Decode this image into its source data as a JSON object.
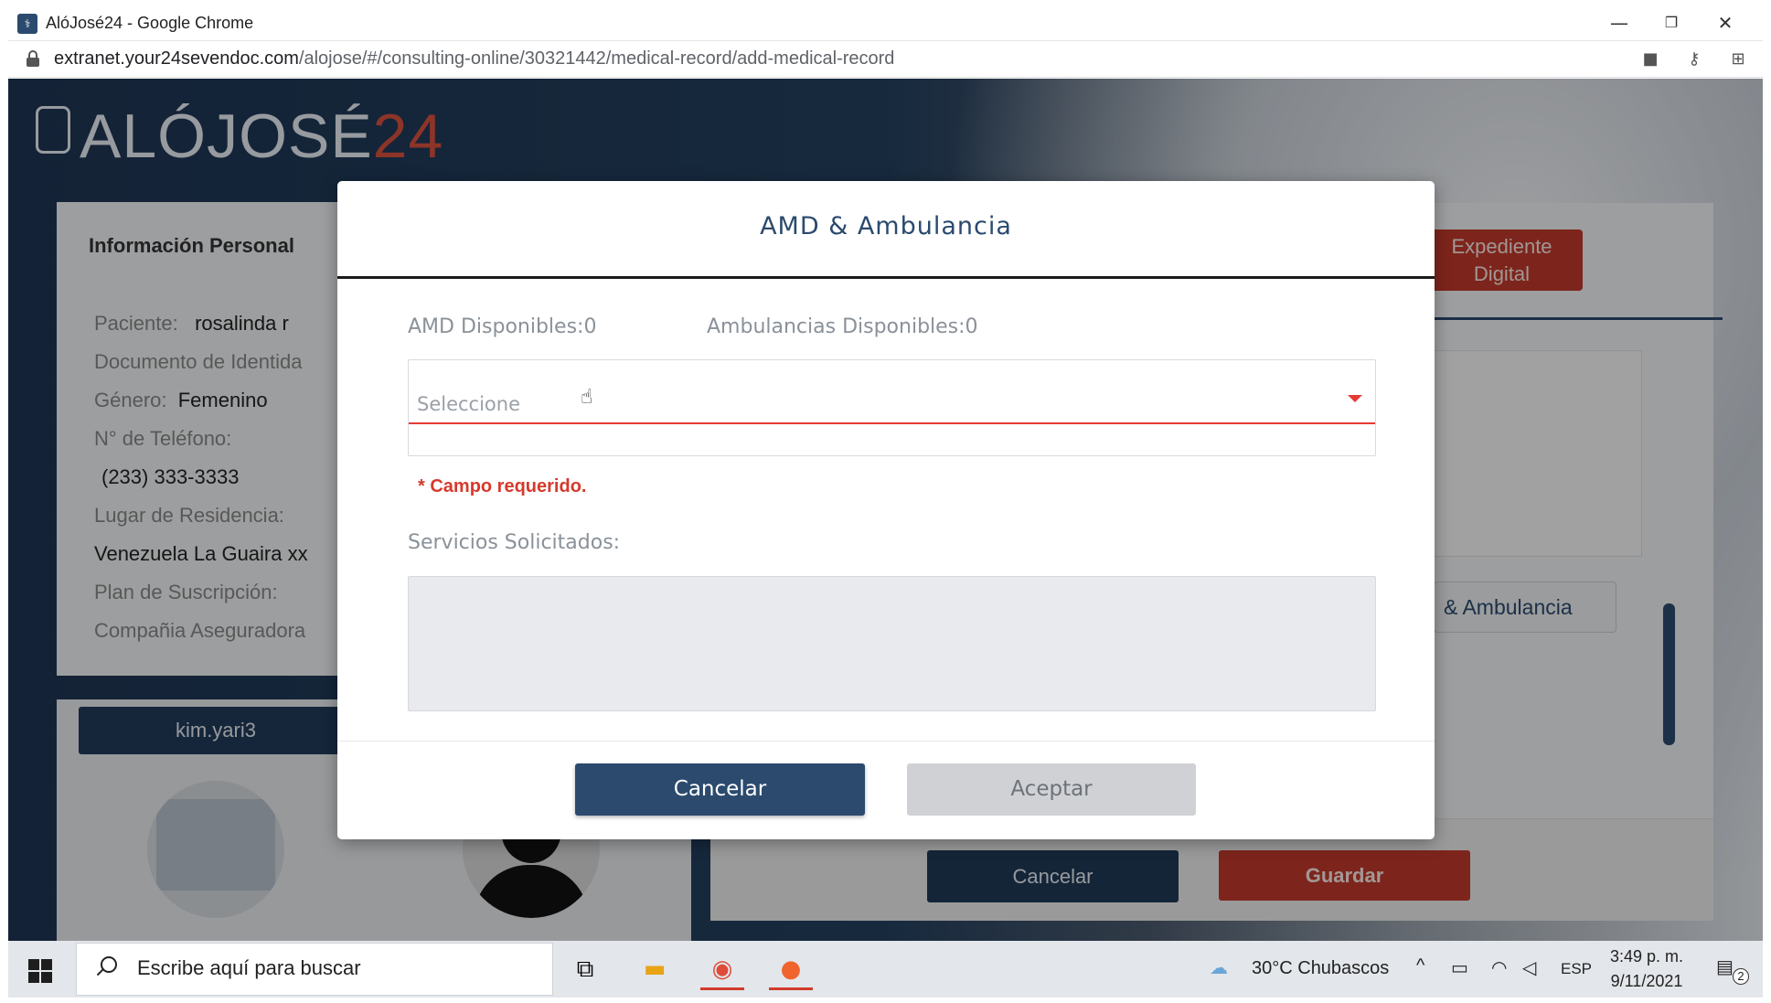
{
  "browser": {
    "window_title": "AlóJosé24 - Google Chrome",
    "url_host": "extranet.your24sevendoc.com",
    "url_path": "/alojose/#/consulting-online/30321442/medical-record/add-medical-record",
    "icons": [
      "lock-icon",
      "camera-icon",
      "key-icon",
      "translate-icon"
    ]
  },
  "app": {
    "logo_text": "ALÓJOSÉ",
    "logo_num": "24",
    "info_title": "Información Personal",
    "fields": {
      "paciente_label": "Paciente:",
      "paciente_value": "rosalinda r",
      "documento_label": "Documento de Identida",
      "genero_label": "Género:",
      "genero_value": "Femenino",
      "telefono_label": "N° de Teléfono:",
      "telefono_value": "(233) 333-3333",
      "residencia_label": "Lugar de Residencia:",
      "residencia_value": "Venezuela La Guaira xx",
      "plan_label": "Plan de Suscripción:",
      "compania_label": "Compañia Aseguradora"
    },
    "user_tag": "kim.yari3",
    "expediente_button": "Expediente Digital",
    "amb_button_partial": "& Ambulancia",
    "cancel_bg": "Cancelar",
    "guardar_bg": "Guardar"
  },
  "modal": {
    "title": "AMD & Ambulancia",
    "amd_available": "AMD Disponibles:0",
    "amb_available": "Ambulancias Disponibles:0",
    "select_placeholder": "Seleccione",
    "required_msg": "* Campo requerido.",
    "services_label": "Servicios Solicitados:",
    "cancel_label": "Cancelar",
    "accept_label": "Aceptar"
  },
  "taskbar": {
    "search_placeholder": "Escribe aquí para buscar",
    "weather": "30°C  Chubascos",
    "language": "ESP",
    "time": "3:49 p. m.",
    "date": "9/11/2021",
    "notifications": "2"
  },
  "colors": {
    "primary": "#2b4a6e",
    "danger": "#d63a2c",
    "disabled": "#cfd1d4"
  }
}
